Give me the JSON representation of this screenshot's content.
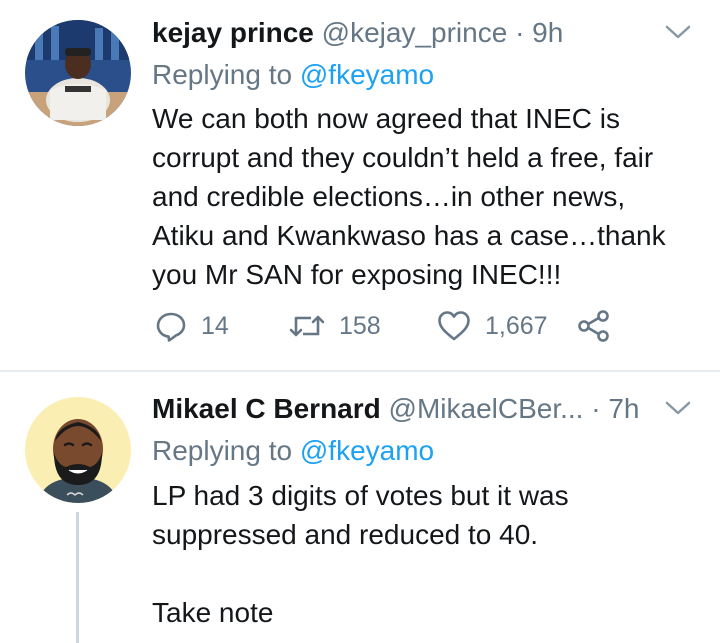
{
  "tweets": [
    {
      "name": "kejay prince",
      "handle": "@kejay_prince",
      "separator": "·",
      "time": "9h",
      "replying_prefix": "Replying to",
      "replying_to": "@fkeyamo",
      "text_lines": [
        "We can both now agreed that INEC is",
        "corrupt and they couldn’t held a free, fair",
        "and credible elections…in other news,",
        "Atiku and Kwankwaso has a case…thank",
        "you Mr SAN for exposing INEC!!!"
      ],
      "reply_count": "14",
      "retweet_count": "158",
      "like_count": "1,667"
    },
    {
      "name": "Mikael C Bernard",
      "handle": "@MikaelCBer...",
      "separator": "·",
      "time": "7h",
      "replying_prefix": "Replying to",
      "replying_to": "@fkeyamo",
      "text_lines": [
        "LP had 3 digits of votes but it was",
        "suppressed and reduced to 40.",
        "",
        "Take note"
      ]
    }
  ],
  "icons": [
    "reply-icon",
    "retweet-icon",
    "like-icon",
    "share-icon",
    "chevron-down-icon"
  ],
  "colors": {
    "muted": "#657786",
    "link": "#1da1f2",
    "text": "#14171a",
    "divider": "#e6ecf0"
  }
}
